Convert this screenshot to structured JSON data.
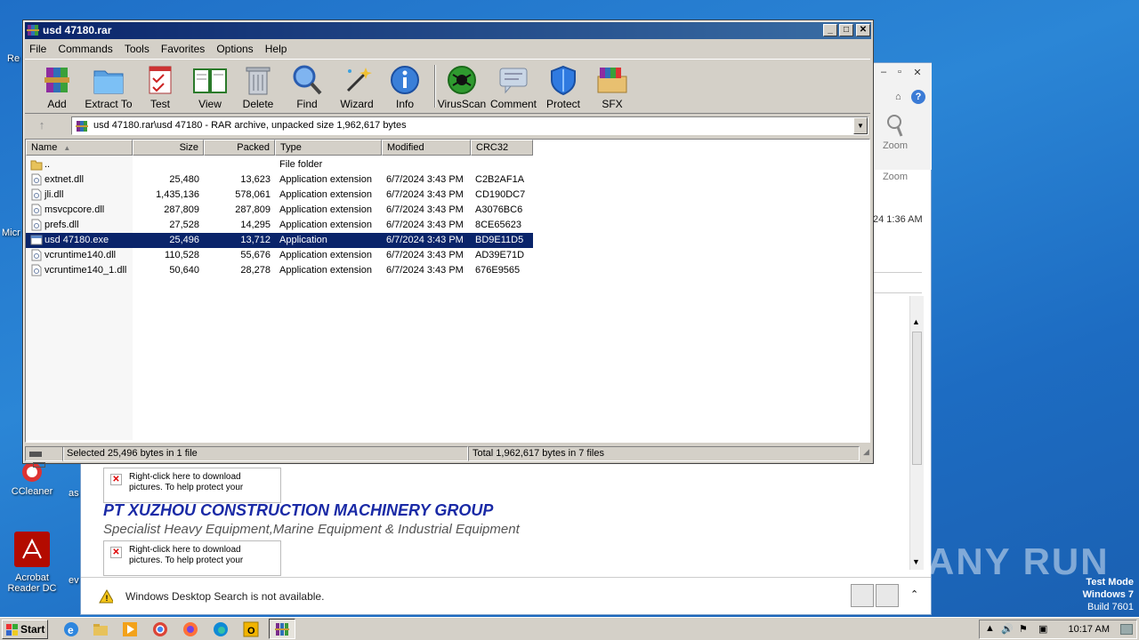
{
  "desktop": {
    "icons": [
      {
        "label": "CCleaner"
      },
      {
        "label": "Acrobat Reader DC"
      }
    ],
    "partial_labels": {
      "left_top": "Re",
      "left_mid": "Micr",
      "right_mid": "as",
      "right_low": "ev"
    }
  },
  "background_window": {
    "zoom_label": "Zoom",
    "zoom_group": "Zoom",
    "time_partial": "24 1:36 AM",
    "image_placeholder_1": "Right-click here to download pictures. To help protect your",
    "image_placeholder_2": "Right-click here to download pictures. To help protect your",
    "company": "PT XUZHOU CONSTRUCTION MACHINERY GROUP",
    "tagline": "Specialist Heavy Equipment,Marine Equipment & Industrial Equipment",
    "info_message": "Windows Desktop Search is not available."
  },
  "window": {
    "title": "usd 47180.rar",
    "menu": [
      "File",
      "Commands",
      "Tools",
      "Favorites",
      "Options",
      "Help"
    ],
    "toolbar": [
      {
        "label": "Add",
        "icon": "add-icon"
      },
      {
        "label": "Extract To",
        "icon": "extract-icon"
      },
      {
        "label": "Test",
        "icon": "test-icon"
      },
      {
        "label": "View",
        "icon": "view-icon"
      },
      {
        "label": "Delete",
        "icon": "delete-icon"
      },
      {
        "label": "Find",
        "icon": "find-icon"
      },
      {
        "label": "Wizard",
        "icon": "wizard-icon"
      },
      {
        "label": "Info",
        "icon": "info-icon"
      },
      {
        "label": "VirusScan",
        "icon": "virusscan-icon"
      },
      {
        "label": "Comment",
        "icon": "comment-icon"
      },
      {
        "label": "Protect",
        "icon": "protect-icon"
      },
      {
        "label": "SFX",
        "icon": "sfx-icon"
      }
    ],
    "path": "usd 47180.rar\\usd 47180 - RAR archive, unpacked size 1,962,617 bytes",
    "columns": [
      "Name",
      "Size",
      "Packed",
      "Type",
      "Modified",
      "CRC32"
    ],
    "files": [
      {
        "name": "..",
        "size": "",
        "packed": "",
        "type": "File folder",
        "modified": "",
        "crc": "",
        "kind": "folder"
      },
      {
        "name": "extnet.dll",
        "size": "25,480",
        "packed": "13,623",
        "type": "Application extension",
        "modified": "6/7/2024 3:43 PM",
        "crc": "C2B2AF1A",
        "kind": "dll"
      },
      {
        "name": "jli.dll",
        "size": "1,435,136",
        "packed": "578,061",
        "type": "Application extension",
        "modified": "6/7/2024 3:43 PM",
        "crc": "CD190DC7",
        "kind": "dll"
      },
      {
        "name": "msvcpcore.dll",
        "size": "287,809",
        "packed": "287,809",
        "type": "Application extension",
        "modified": "6/7/2024 3:43 PM",
        "crc": "A3076BC6",
        "kind": "dll"
      },
      {
        "name": "prefs.dll",
        "size": "27,528",
        "packed": "14,295",
        "type": "Application extension",
        "modified": "6/7/2024 3:43 PM",
        "crc": "8CE65623",
        "kind": "dll"
      },
      {
        "name": "usd 47180.exe",
        "size": "25,496",
        "packed": "13,712",
        "type": "Application",
        "modified": "6/7/2024 3:43 PM",
        "crc": "BD9E11D5",
        "kind": "exe",
        "selected": true
      },
      {
        "name": "vcruntime140.dll",
        "size": "110,528",
        "packed": "55,676",
        "type": "Application extension",
        "modified": "6/7/2024 3:43 PM",
        "crc": "AD39E71D",
        "kind": "dll"
      },
      {
        "name": "vcruntime140_1.dll",
        "size": "50,640",
        "packed": "28,278",
        "type": "Application extension",
        "modified": "6/7/2024 3:43 PM",
        "crc": "676E9565",
        "kind": "dll"
      }
    ],
    "status_left": "Selected 25,496 bytes in 1 file",
    "status_right": "Total 1,962,617 bytes in 7 files"
  },
  "taskbar": {
    "start_label": "Start",
    "clock": "10:17 AM"
  },
  "overlay": {
    "watermark": "ANY RUN",
    "test_mode": "Test Mode",
    "os": "Windows 7",
    "build": "Build 7601"
  }
}
